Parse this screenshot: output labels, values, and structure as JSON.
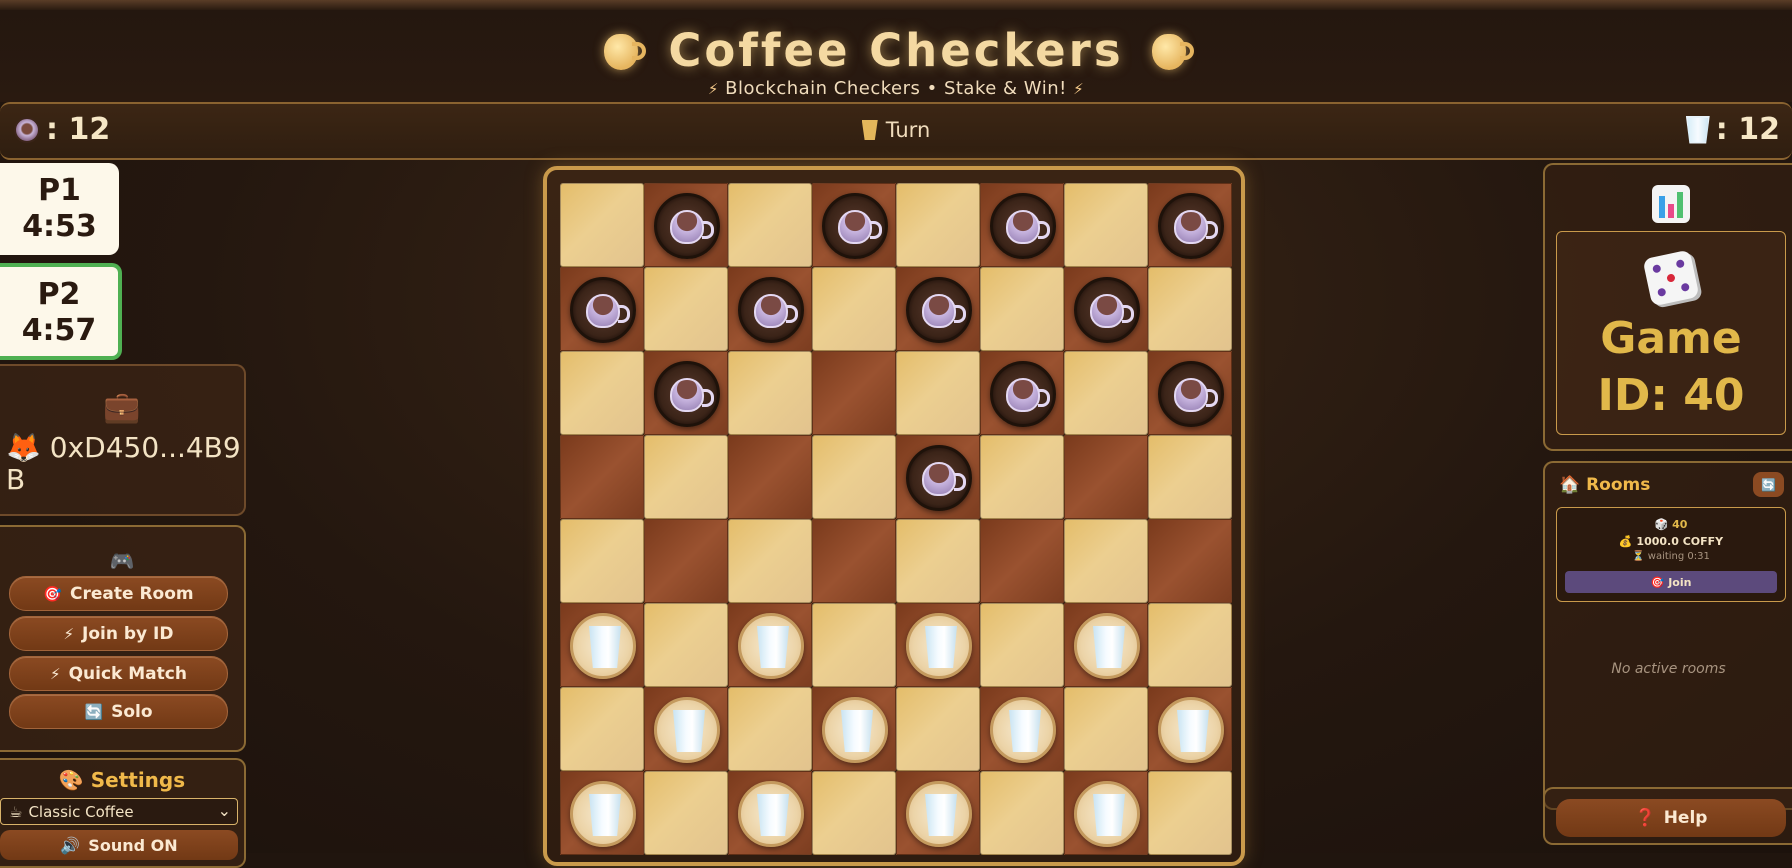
{
  "header": {
    "title": "Coffee Checkers",
    "subtitle": "Blockchain Checkers • Stake & Win!"
  },
  "scorebar": {
    "left_score": ": 12",
    "turn_label": "Turn",
    "right_score": ": 12"
  },
  "timers": {
    "p1_name": "P1",
    "p1_time": "4:53",
    "p2_name": "P2",
    "p2_time": "4:57",
    "active": "P2"
  },
  "wallet": {
    "address": "0xD450...4B9B"
  },
  "actions": {
    "create_room": "Create Room",
    "join_by_id": "Join by ID",
    "quick_match": "Quick Match",
    "solo": "Solo"
  },
  "settings": {
    "title": "Settings",
    "theme_selected": "Classic Coffee",
    "sound": "Sound ON"
  },
  "game": {
    "id_label": "Game",
    "id_value": "ID: 40"
  },
  "rooms": {
    "title": "Rooms",
    "list": [
      {
        "id": "40",
        "stake": "1000.0 COFFY",
        "status": "waiting 0:31",
        "join_label": "Join"
      }
    ],
    "empty_text": "No active rooms"
  },
  "help": {
    "label": "Help"
  },
  "board": {
    "rows": [
      ".c.c.c.c",
      "c.c.c.c.",
      ".c...c.c",
      "....c...",
      "........",
      "m.m.m.m.",
      ".m.m.m.m",
      "m.m.m.m."
    ]
  },
  "colors": {
    "accent_gold": "#e1b84a",
    "button_brown": "#8b4a22",
    "active_timer_border": "#4fb052"
  }
}
